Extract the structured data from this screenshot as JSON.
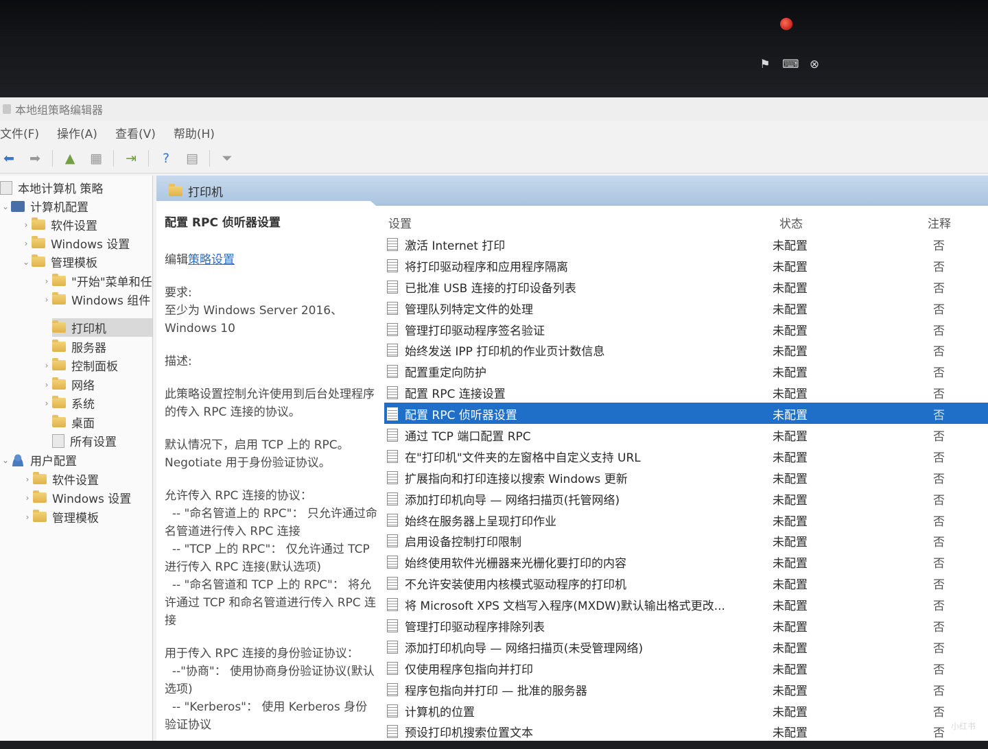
{
  "window": {
    "title": "本地组策略编辑器"
  },
  "menu": [
    "文件(F)",
    "操作(A)",
    "查看(V)",
    "帮助(H)"
  ],
  "tree": {
    "root": "本地计算机 策略",
    "computer": "计算机配置",
    "computer_children": [
      "软件设置",
      "Windows 设置",
      "管理模板"
    ],
    "admin_children": [
      "\"开始\"菜单和任",
      "Windows 组件",
      "打印机",
      "服务器",
      "控制面板",
      "网络",
      "系统",
      "桌面",
      "所有设置"
    ],
    "user": "用户配置",
    "user_children": [
      "软件设置",
      "Windows 设置",
      "管理模板"
    ]
  },
  "content": {
    "header": "打印机",
    "desc": {
      "title": "配置 RPC 侦听器设置",
      "edit_prefix": "编辑",
      "edit_link": "策略设置",
      "req_label": "要求:",
      "req_text": "至少为 Windows Server 2016、Windows 10",
      "desc_label": "描述:",
      "p1": "此策略设置控制允许使用到后台处理程序的传入 RPC 连接的协议。",
      "p2": "默认情况下，启用 TCP 上的 RPC。Negotiate 用于身份验证协议。",
      "p3": "允许传入 RPC 连接的协议：\n  -- \"命名管道上的 RPC\"： 只允许通过命名管道进行传入 RPC 连接\n  -- \"TCP 上的 RPC\"： 仅允许通过 TCP 进行传入 RPC 连接(默认选项)\n  -- \"命名管道和 TCP 上的 RPC\"： 将允许通过 TCP 和命名管道进行传入 RPC 连接",
      "p4": "用于传入 RPC 连接的身份验证协议：\n  --\"协商\"： 使用协商身份验证协议(默认选项)\n  -- \"Kerberos\"： 使用 Kerberos 身份验证协议"
    },
    "columns": {
      "setting": "设置",
      "state": "状态",
      "note": "注释"
    },
    "rows": [
      {
        "name": "激活 Internet 打印",
        "state": "未配置",
        "note": "否"
      },
      {
        "name": "将打印驱动程序和应用程序隔离",
        "state": "未配置",
        "note": "否"
      },
      {
        "name": "已批准 USB 连接的打印设备列表",
        "state": "未配置",
        "note": "否"
      },
      {
        "name": "管理队列特定文件的处理",
        "state": "未配置",
        "note": "否"
      },
      {
        "name": "管理打印驱动程序签名验证",
        "state": "未配置",
        "note": "否"
      },
      {
        "name": "始终发送 IPP 打印机的作业页计数信息",
        "state": "未配置",
        "note": "否"
      },
      {
        "name": "配置重定向防护",
        "state": "未配置",
        "note": "否"
      },
      {
        "name": "配置 RPC 连接设置",
        "state": "未配置",
        "note": "否"
      },
      {
        "name": "配置 RPC 侦听器设置",
        "state": "未配置",
        "note": "否"
      },
      {
        "name": "通过 TCP 端口配置 RPC",
        "state": "未配置",
        "note": "否"
      },
      {
        "name": "在\"打印机\"文件夹的左窗格中自定义支持 URL",
        "state": "未配置",
        "note": "否"
      },
      {
        "name": "扩展指向和打印连接以搜索 Windows 更新",
        "state": "未配置",
        "note": "否"
      },
      {
        "name": "添加打印机向导 — 网络扫描页(托管网络)",
        "state": "未配置",
        "note": "否"
      },
      {
        "name": "始终在服务器上呈现打印作业",
        "state": "未配置",
        "note": "否"
      },
      {
        "name": "启用设备控制打印限制",
        "state": "未配置",
        "note": "否"
      },
      {
        "name": "始终使用软件光栅器来光栅化要打印的内容",
        "state": "未配置",
        "note": "否"
      },
      {
        "name": "不允许安装使用内核模式驱动程序的打印机",
        "state": "未配置",
        "note": "否"
      },
      {
        "name": "将 Microsoft XPS 文档写入程序(MXDW)默认输出格式更改...",
        "state": "未配置",
        "note": "否"
      },
      {
        "name": "管理打印驱动程序排除列表",
        "state": "未配置",
        "note": "否"
      },
      {
        "name": "添加打印机向导 — 网络扫描页(未受管理网络)",
        "state": "未配置",
        "note": "否"
      },
      {
        "name": "仅使用程序包指向并打印",
        "state": "未配置",
        "note": "否"
      },
      {
        "name": "程序包指向并打印 — 批准的服务器",
        "state": "未配置",
        "note": "否"
      },
      {
        "name": "计算机的位置",
        "state": "未配置",
        "note": "否"
      },
      {
        "name": "预设打印机搜索位置文本",
        "state": "未配置",
        "note": "否"
      }
    ],
    "selected_index": 8
  },
  "watermark": "小红书"
}
